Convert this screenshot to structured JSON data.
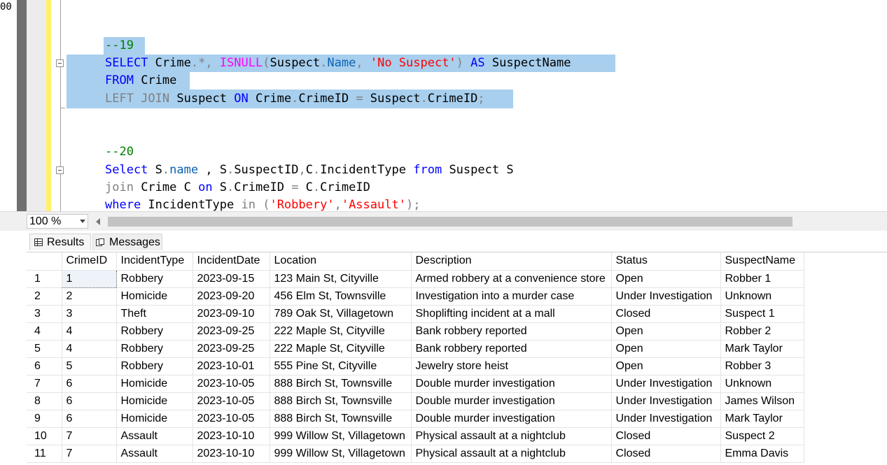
{
  "editor": {
    "line_number_fragment": "00",
    "lines": [
      {
        "tokens": [
          {
            "t": "--19",
            "c": "cm"
          }
        ]
      },
      {
        "tokens": [
          {
            "t": "SELECT",
            "c": "kw"
          },
          {
            "t": " Crime",
            "c": "id"
          },
          {
            "t": ".*,",
            "c": "gray"
          },
          {
            "t": " ",
            "c": "id"
          },
          {
            "t": "ISNULL",
            "c": "fn"
          },
          {
            "t": "(",
            "c": "gray"
          },
          {
            "t": "Suspect",
            "c": "id"
          },
          {
            "t": ".",
            "c": "gray"
          },
          {
            "t": "Name",
            "c": "col"
          },
          {
            "t": ",",
            "c": "gray"
          },
          {
            "t": " ",
            "c": "id"
          },
          {
            "t": "'No Suspect'",
            "c": "str"
          },
          {
            "t": ")",
            "c": "gray"
          },
          {
            "t": " ",
            "c": "id"
          },
          {
            "t": "AS",
            "c": "kw"
          },
          {
            "t": " SuspectName",
            "c": "id"
          }
        ]
      },
      {
        "tokens": [
          {
            "t": "FROM",
            "c": "kw"
          },
          {
            "t": " Crime",
            "c": "id"
          }
        ]
      },
      {
        "tokens": [
          {
            "t": "LEFT JOIN",
            "c": "gray"
          },
          {
            "t": " Suspect ",
            "c": "id"
          },
          {
            "t": "ON",
            "c": "kw"
          },
          {
            "t": " Crime",
            "c": "id"
          },
          {
            "t": ".",
            "c": "gray"
          },
          {
            "t": "CrimeID",
            "c": "id"
          },
          {
            "t": " = ",
            "c": "gray"
          },
          {
            "t": "Suspect",
            "c": "id"
          },
          {
            "t": ".",
            "c": "gray"
          },
          {
            "t": "CrimeID",
            "c": "id"
          },
          {
            "t": ";",
            "c": "gray"
          }
        ]
      },
      {
        "tokens": [
          {
            "t": "--20",
            "c": "cm"
          }
        ]
      },
      {
        "tokens": [
          {
            "t": "Select",
            "c": "kw"
          },
          {
            "t": " S",
            "c": "id"
          },
          {
            "t": ".",
            "c": "gray"
          },
          {
            "t": "name",
            "c": "col"
          },
          {
            "t": " , S",
            "c": "id"
          },
          {
            "t": ".",
            "c": "gray"
          },
          {
            "t": "SuspectID",
            "c": "id"
          },
          {
            "t": ",",
            "c": "gray"
          },
          {
            "t": "C",
            "c": "id"
          },
          {
            "t": ".",
            "c": "gray"
          },
          {
            "t": "IncidentType ",
            "c": "id"
          },
          {
            "t": "from",
            "c": "kw"
          },
          {
            "t": " Suspect S",
            "c": "id"
          }
        ]
      },
      {
        "tokens": [
          {
            "t": "join",
            "c": "gray"
          },
          {
            "t": " Crime C ",
            "c": "id"
          },
          {
            "t": "on",
            "c": "kw"
          },
          {
            "t": " S",
            "c": "id"
          },
          {
            "t": ".",
            "c": "gray"
          },
          {
            "t": "CrimeID",
            "c": "id"
          },
          {
            "t": " = ",
            "c": "gray"
          },
          {
            "t": "C",
            "c": "id"
          },
          {
            "t": ".",
            "c": "gray"
          },
          {
            "t": "CrimeID",
            "c": "id"
          }
        ]
      },
      {
        "tokens": [
          {
            "t": "where",
            "c": "kw"
          },
          {
            "t": " IncidentType ",
            "c": "id"
          },
          {
            "t": "in",
            "c": "gray"
          },
          {
            "t": " (",
            "c": "gray"
          },
          {
            "t": "'Robbery'",
            "c": "str"
          },
          {
            "t": ",",
            "c": "gray"
          },
          {
            "t": "'Assault'",
            "c": "str"
          },
          {
            "t": ");",
            "c": "gray"
          }
        ]
      }
    ]
  },
  "toolbar": {
    "zoom_value": "100 %"
  },
  "tabs": {
    "results_label": "Results",
    "messages_label": "Messages"
  },
  "grid": {
    "columns": [
      "CrimeID",
      "IncidentType",
      "IncidentDate",
      "Location",
      "Description",
      "Status",
      "SuspectName"
    ],
    "rows": [
      [
        "1",
        "1",
        "Robbery",
        "2023-09-15",
        "123 Main St, Cityville",
        "Armed robbery at a convenience store",
        "Open",
        "Robber 1"
      ],
      [
        "2",
        "2",
        "Homicide",
        "2023-09-20",
        "456 Elm St, Townsville",
        "Investigation into a murder case",
        "Under Investigation",
        "Unknown"
      ],
      [
        "3",
        "3",
        "Theft",
        "2023-09-10",
        "789 Oak St, Villagetown",
        "Shoplifting incident at a mall",
        "Closed",
        "Suspect 1"
      ],
      [
        "4",
        "4",
        "Robbery",
        "2023-09-25",
        "222 Maple St, Cityville",
        "Bank robbery reported",
        "Open",
        "Robber 2"
      ],
      [
        "5",
        "4",
        "Robbery",
        "2023-09-25",
        "222 Maple St, Cityville",
        "Bank robbery reported",
        "Open",
        "Mark Taylor"
      ],
      [
        "6",
        "5",
        "Robbery",
        "2023-10-01",
        "555 Pine St, Cityville",
        "Jewelry store heist",
        "Open",
        "Robber 3"
      ],
      [
        "7",
        "6",
        "Homicide",
        "2023-10-05",
        "888 Birch St, Townsville",
        "Double murder investigation",
        "Under Investigation",
        "Unknown"
      ],
      [
        "8",
        "6",
        "Homicide",
        "2023-10-05",
        "888 Birch St, Townsville",
        "Double murder investigation",
        "Under Investigation",
        "James Wilson"
      ],
      [
        "9",
        "6",
        "Homicide",
        "2023-10-05",
        "888 Birch St, Townsville",
        "Double murder investigation",
        "Under Investigation",
        "Mark Taylor"
      ],
      [
        "10",
        "7",
        "Assault",
        "2023-10-10",
        "999 Willow St, Villagetown",
        "Physical assault at a nightclub",
        "Closed",
        "Suspect 2"
      ],
      [
        "11",
        "7",
        "Assault",
        "2023-10-10",
        "999 Willow St, Villagetown",
        "Physical assault at a nightclub",
        "Closed",
        "Emma Davis"
      ]
    ]
  },
  "icons": {
    "fold": "collapse-box-icon",
    "results": "grid-icon",
    "messages": "messages-icon",
    "zoom_dropdown": "chevron-down-icon",
    "scroll_left": "scroll-left-arrow-icon"
  },
  "colors": {
    "selection": "#a8cfee",
    "keyword": "#0000ff",
    "function": "#ff00ff",
    "string": "#ff0000",
    "comment": "#008000",
    "operator": "#808080",
    "change_bar": "#fff26b"
  }
}
